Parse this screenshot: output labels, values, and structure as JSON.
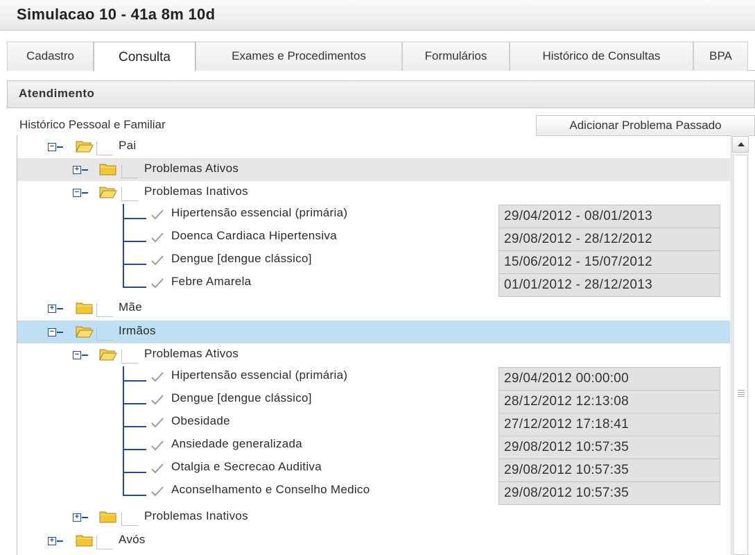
{
  "window": {
    "title": "Simulacao 10 - 41a 8m 10d"
  },
  "tabs": [
    {
      "label": "Cadastro"
    },
    {
      "label": "Consulta",
      "active": true
    },
    {
      "label": "Exames e Procedimentos"
    },
    {
      "label": "Formulários"
    },
    {
      "label": "Histórico de Consultas"
    },
    {
      "label": "BPA"
    }
  ],
  "section": {
    "title": "Atendimento"
  },
  "history": {
    "heading": "Histórico Pessoal e Familiar",
    "add_button": "Adicionar Problema Passado"
  },
  "tree": {
    "pai": {
      "label": "Pai",
      "ativos_label": "Problemas Ativos",
      "inativos_label": "Problemas Inativos",
      "inativos": [
        {
          "label": "Hipertensão essencial (primária)",
          "date": "29/04/2012 - 08/01/2013"
        },
        {
          "label": "Doenca Cardiaca Hipertensiva",
          "date": "29/08/2012 - 28/12/2012"
        },
        {
          "label": "Dengue [dengue clássico]",
          "date": "15/06/2012 - 15/07/2012"
        },
        {
          "label": "Febre Amarela",
          "date": "01/01/2012 - 28/12/2013"
        }
      ]
    },
    "mae": {
      "label": "Mãe"
    },
    "irmaos": {
      "label": "Irmãos",
      "ativos_label": "Problemas Ativos",
      "inativos_label": "Problemas Inativos",
      "ativos": [
        {
          "label": "Hipertensão essencial (primária)",
          "date": "29/04/2012 00:00:00"
        },
        {
          "label": "Dengue [dengue clássico]",
          "date": "28/12/2012 12:13:08"
        },
        {
          "label": "Obesidade",
          "date": "27/12/2012 17:18:41"
        },
        {
          "label": "Ansiedade generalizada",
          "date": "29/08/2012 10:57:35"
        },
        {
          "label": "Otalgia e Secrecao Auditiva",
          "date": "29/08/2012 10:57:35"
        },
        {
          "label": "Aconselhamento e Conselho Medico",
          "date": "29/08/2012 10:57:35"
        }
      ]
    },
    "avos": {
      "label": "Avós"
    }
  },
  "icons": {
    "collapse": "minus-box-icon",
    "expand": "plus-box-icon",
    "folder_open": "folder-open-icon",
    "folder_closed": "folder-closed-icon",
    "check": "check-icon"
  },
  "colors": {
    "selected_row": "#bfe0f3",
    "hover_row": "#e7e7e7",
    "tree_line": "#1f4e96",
    "folder": "#f4cb2e"
  }
}
